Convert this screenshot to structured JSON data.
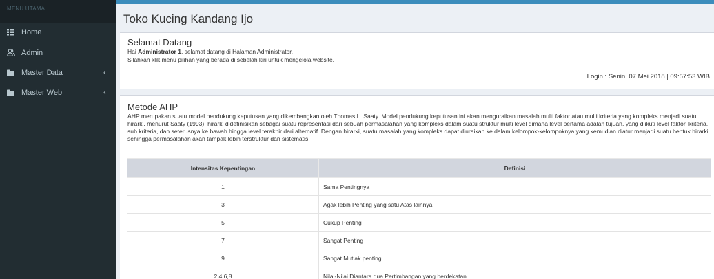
{
  "sidebar": {
    "header": "MENU UTAMA",
    "items": [
      {
        "icon": "grid-icon",
        "label": "Home"
      },
      {
        "icon": "users-icon",
        "label": "Admin"
      },
      {
        "icon": "folder-icon",
        "label": "Master Data",
        "chevron": "‹"
      },
      {
        "icon": "folder-icon",
        "label": "Master Web",
        "chevron": "‹"
      }
    ]
  },
  "header": {
    "title": "Toko Kucing Kandang Ijo"
  },
  "welcome": {
    "title": "Selamat Datang",
    "line1_prefix": "Hai ",
    "user": "Administrator 1",
    "line1_suffix": ", selamat datang di Halaman Administrator.",
    "line2": "Silahkan klik menu pilihan yang berada di sebelah kiri untuk mengelola website.",
    "login": "Login : Senin, 07 Mei 2018 | 09:57:53 WIB"
  },
  "ahp": {
    "title": "Metode AHP",
    "description": "AHP merupakan suatu model pendukung keputusan yang dikembangkan oleh Thomas L. Saaty. Model pendukung keputusan ini akan menguraikan masalah multi faktor atau multi kriteria yang kompleks menjadi suatu hirarki, menurut Saaty (1993), hirarki didefinisikan sebagai suatu representasi dari sebuah permasalahan yang kompleks dalam suatu struktur multi level dimana level pertama adalah tujuan, yang diikuti level faktor, kriteria, sub kriteria, dan seterusnya ke bawah hingga level terakhir dari alternatif. Dengan hirarki, suatu masalah yang kompleks dapat diuraikan ke dalam kelompok-kelompoknya yang kemudian diatur menjadi suatu bentuk hirarki sehingga permasalahan akan tampak lebih terstruktur dan sistematis",
    "table": {
      "headers": [
        "Intensitas Kepentingan",
        "Definisi"
      ],
      "rows": [
        [
          "1",
          "Sama Pentingnya"
        ],
        [
          "3",
          "Agak lebih Penting yang satu Atas lainnya"
        ],
        [
          "5",
          "Cukup Penting"
        ],
        [
          "7",
          "Sangat Penting"
        ],
        [
          "9",
          "Sangat Mutlak penting"
        ],
        [
          "2,4,6,8",
          "Nilai-Nilai Diantara dua Pertimbangan yang berdekatan"
        ]
      ]
    }
  },
  "colors": {
    "sidebar_bg": "#222d32",
    "sidebar_header_bg": "#1a2226",
    "accent": "#3c8dbc",
    "table_header_bg": "#d2d6de"
  }
}
